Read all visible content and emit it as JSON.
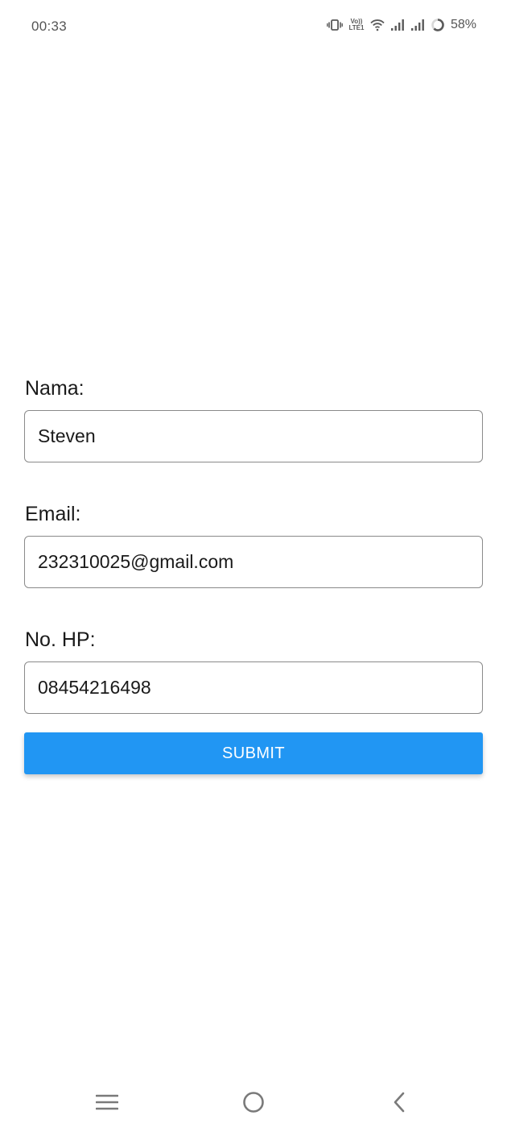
{
  "status_bar": {
    "time": "00:33",
    "network_badge_top": "Vo))",
    "network_badge_bottom": "LTE1",
    "battery": "58%",
    "icons": [
      "vibrate-icon",
      "volte-icon",
      "wifi-icon",
      "signal-icon",
      "signal-icon",
      "battery-icon"
    ]
  },
  "form": {
    "name_label": "Nama:",
    "name_value": "Steven",
    "email_label": "Email:",
    "email_value": "232310025@gmail.com",
    "phone_label": "No. HP:",
    "phone_value": "08454216498",
    "submit_label": "SUBMIT"
  },
  "nav_bar": {
    "icons": [
      "menu-icon",
      "home-icon",
      "back-icon"
    ]
  },
  "colors": {
    "accent": "#2196f3",
    "input_border": "#8a8a8a",
    "status_text": "#555555"
  }
}
